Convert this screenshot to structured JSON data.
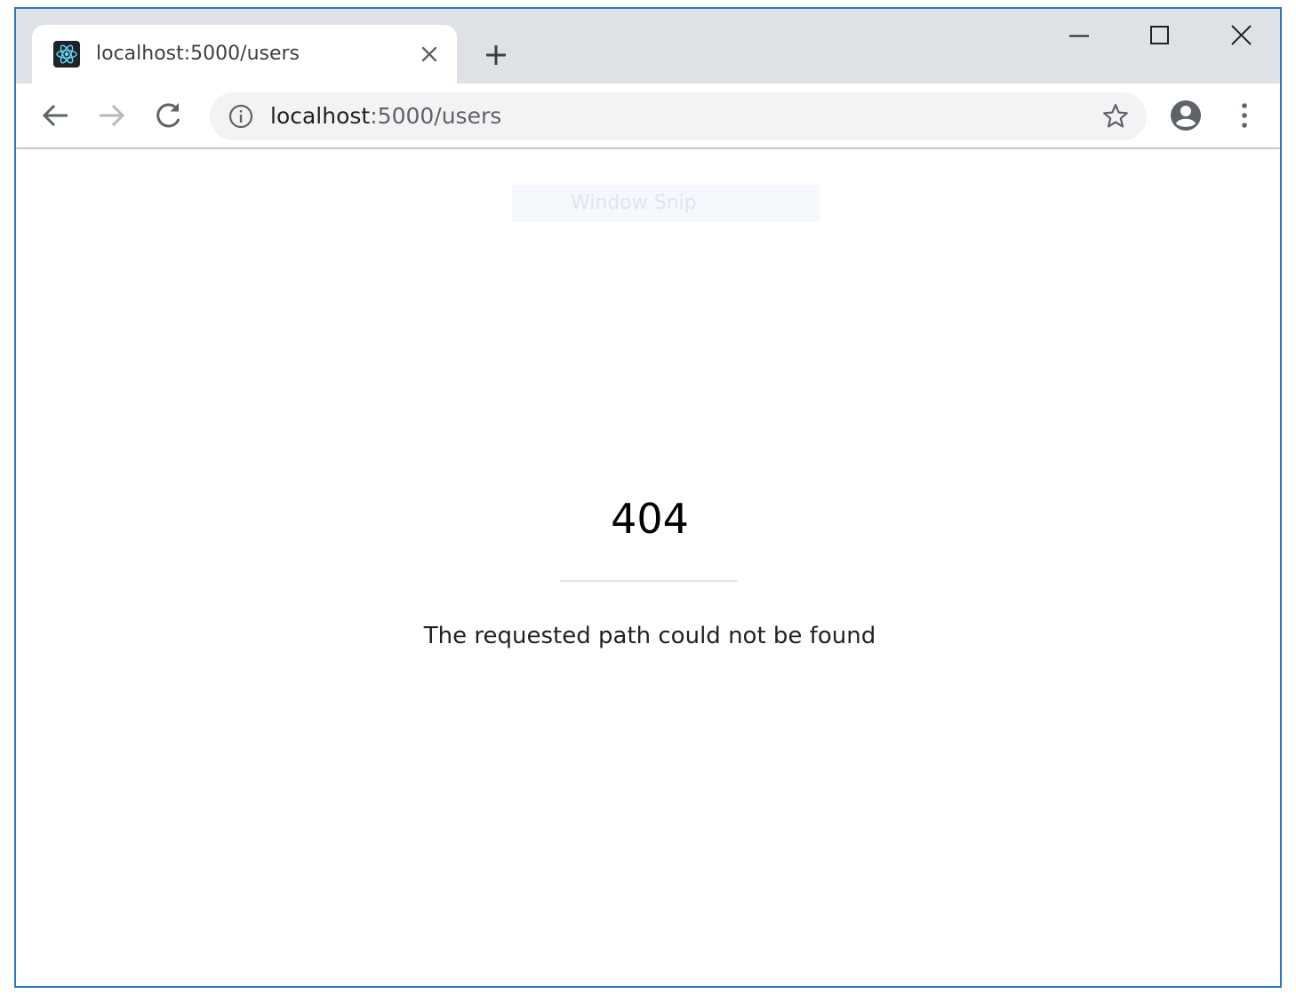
{
  "browser": {
    "tab": {
      "title": "localhost:5000/users",
      "favicon": "react-logo-icon"
    },
    "new_tab_icon": "plus-icon",
    "window_controls": [
      "minimize-icon",
      "maximize-icon",
      "close-icon"
    ],
    "toolbar": {
      "back_icon": "back-arrow-icon",
      "forward_icon": "forward-arrow-icon",
      "reload_icon": "reload-icon",
      "site_info_icon": "info-icon",
      "url_host": "localhost",
      "url_rest": ":5000/users",
      "bookmark_icon": "star-icon",
      "profile_icon": "account-circle-icon",
      "menu_icon": "kebab-menu-icon"
    },
    "colors": {
      "tabstrip": "#dee1e6",
      "window_border": "#2b79c2",
      "omnibox": "#f1f3f4",
      "react_blue": "#61dafb"
    }
  },
  "page": {
    "overlay_label": "Window Snip",
    "error_code": "404",
    "error_message": "The requested path could not be found"
  }
}
